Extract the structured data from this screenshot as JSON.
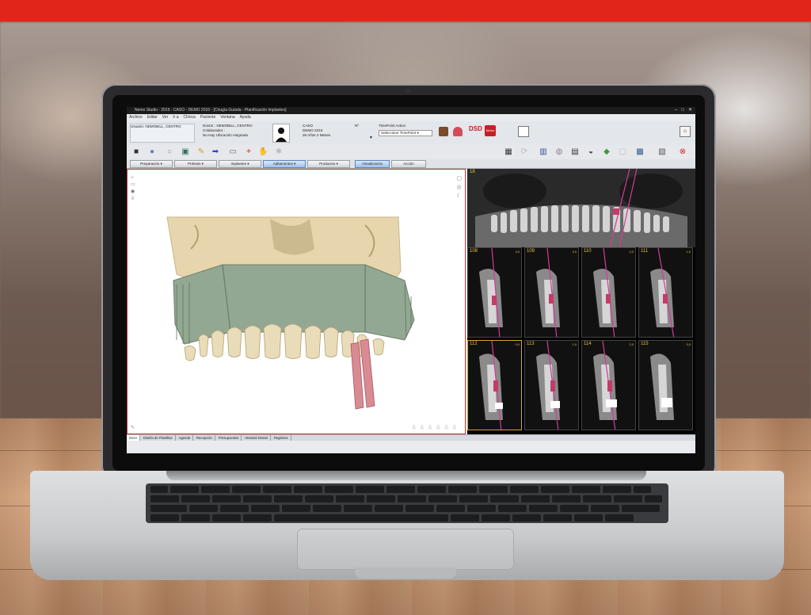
{
  "app": {
    "title": "Nemo Studio - 2016 - CASO - DEMO 2016 - [Cirugía Guiada - Planificación Implantes]",
    "menu": [
      "Archivo",
      "Editar",
      "Ver",
      "Ir a",
      "Clínica",
      "Paciente",
      "Ventana",
      "Ayuda"
    ],
    "window_controls": [
      "–",
      "□",
      "✕"
    ]
  },
  "info": {
    "usuario_label": "Usuario: NEMOBILL, CENTRO",
    "doctor_label": "Doctor : NEMOBILL, CENTRO",
    "colaborador_label": "Colaborador :",
    "ubicacion": "No Hay Ubicación Asignada",
    "caso_label": "CASO",
    "caso_value": "DEMO 2016",
    "edad": "26 Años 2 Meses",
    "numero_label": "Nº",
    "timepoint_label": "TimePoint Activo",
    "timepoint_value": "Seleccione TimePoint",
    "dsd_label": "DSD",
    "nemo_label": "Nemo"
  },
  "tabs": [
    {
      "label": "Preparación",
      "active": false
    },
    {
      "label": "Prótesis",
      "active": false
    },
    {
      "label": "Implantes",
      "active": false
    },
    {
      "label": "Aditamentos",
      "active": true
    },
    {
      "label": "Productos",
      "active": false
    },
    {
      "label": "Visualización",
      "active": true
    },
    {
      "label": "Acción",
      "active": false
    }
  ],
  "slices": [
    {
      "num": "108",
      "scale": "4,0"
    },
    {
      "num": "109",
      "scale": "3,0"
    },
    {
      "num": "110",
      "scale": "2,0"
    },
    {
      "num": "111",
      "scale": "1,0"
    },
    {
      "num": "112",
      "scale": "0,0"
    },
    {
      "num": "113",
      "scale": "1,0"
    },
    {
      "num": "114",
      "scale": "2,0"
    },
    {
      "num": "115",
      "scale": "3,0"
    }
  ],
  "pano": {
    "num": "18"
  },
  "bottom_tabs": [
    {
      "label": "Inicio",
      "active": true
    },
    {
      "label": "Diseño de Plantillas",
      "active": false
    },
    {
      "label": "Agenda",
      "active": false
    },
    {
      "label": "Recepción",
      "active": false
    },
    {
      "label": "Presupuestos",
      "active": false
    },
    {
      "label": "Historial Dental",
      "active": false
    },
    {
      "label": "Registros",
      "active": false
    }
  ],
  "colors": {
    "brand_red": "#e0251b",
    "tab_active": "#9cc1ec",
    "implant": "#d98a93",
    "guide": "#8fa58c",
    "bone": "#e7d6ad"
  }
}
